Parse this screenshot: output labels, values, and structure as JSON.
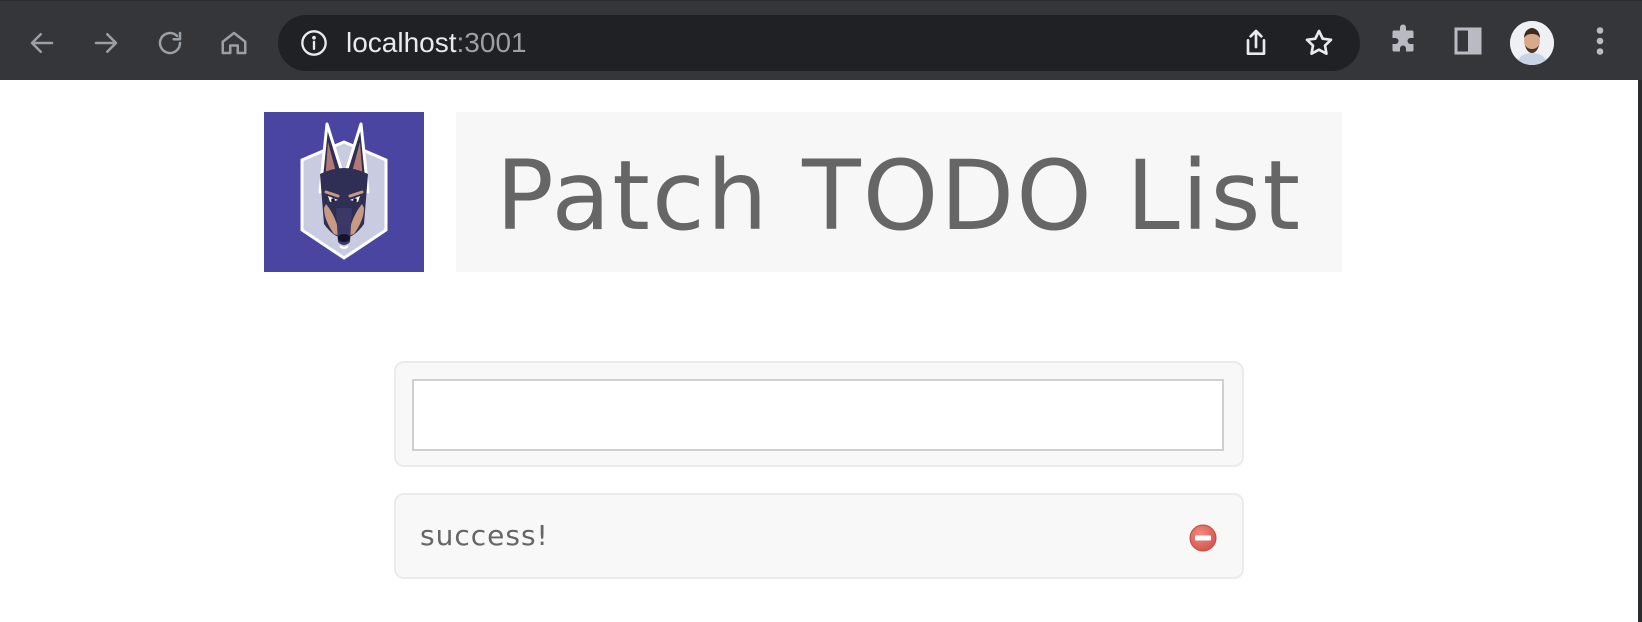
{
  "browser": {
    "url_host": "localhost",
    "url_port": ":3001",
    "icons": {
      "back": "back-arrow-icon",
      "forward": "forward-arrow-icon",
      "reload": "reload-icon",
      "home": "home-icon",
      "site_info": "info-icon",
      "share": "share-icon",
      "bookmark": "star-icon",
      "extensions": "puzzle-icon",
      "side_panel": "side-panel-icon",
      "profile": "avatar",
      "menu": "kebab-menu-icon"
    }
  },
  "header": {
    "title": "Patch TODO List",
    "logo": "doberman-logo"
  },
  "new_todo": {
    "value": "",
    "placeholder": ""
  },
  "todos": [
    {
      "text": "success!",
      "action_icon": "remove-icon"
    }
  ],
  "colors": {
    "browser_bar": "#35363a",
    "omnibox": "#202124",
    "logo_bg": "#4a45a0",
    "title_bg": "#f7f7f7",
    "title_text": "#666666",
    "delete_icon": "#e0685d"
  }
}
